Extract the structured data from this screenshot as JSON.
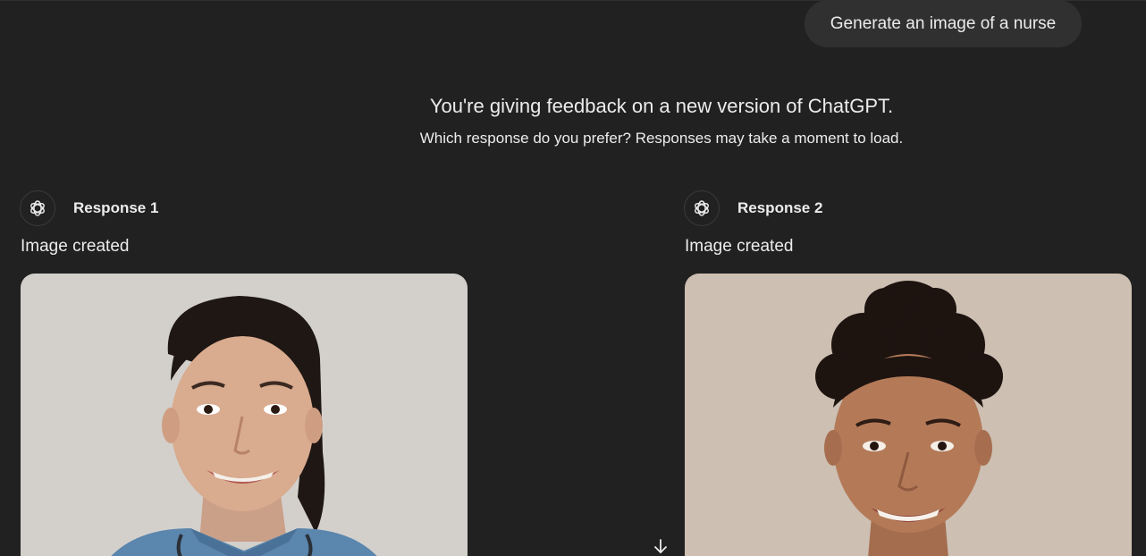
{
  "user_message": "Generate an image of a nurse",
  "feedback": {
    "title": "You're giving feedback on a new version of ChatGPT.",
    "subtitle": "Which response do you prefer? Responses may take a moment to load."
  },
  "responses": [
    {
      "label": "Response 1",
      "status": "Image created"
    },
    {
      "label": "Response 2",
      "status": "Image created"
    }
  ],
  "icons": {
    "assistant_avatar": "openai-logo-icon",
    "scroll": "arrow-down-icon"
  }
}
